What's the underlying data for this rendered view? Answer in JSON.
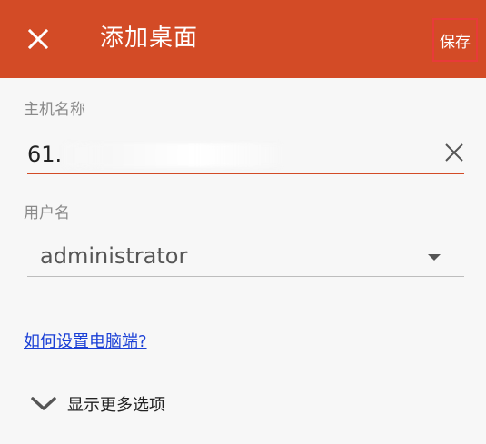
{
  "header": {
    "title": "添加桌面",
    "save_label": "保存",
    "close_icon": "close-icon",
    "background": "#d34b26"
  },
  "hostname": {
    "label": "主机名称",
    "value": "61.",
    "clear_icon": "clear-icon"
  },
  "username": {
    "label": "用户名",
    "value": "administrator",
    "dropdown_icon": "dropdown-arrow-icon"
  },
  "help_link": "如何设置电脑端?",
  "more_options": {
    "label": "显示更多选项",
    "icon": "chevron-down-icon"
  },
  "colors": {
    "accent": "#d34b26",
    "link": "#1a3fd6",
    "save_highlight": "#e83a3a"
  }
}
